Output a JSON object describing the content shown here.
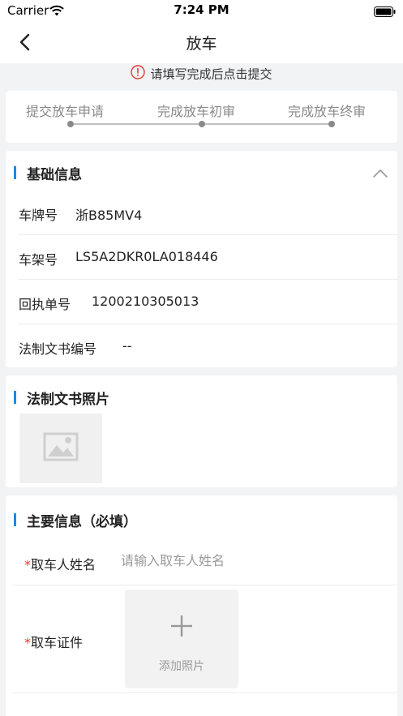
{
  "status_bar": {
    "carrier": "Carrier",
    "time": "7:24 PM"
  },
  "nav": {
    "title": "放车"
  },
  "notice": {
    "text": "请填写完成后点击提交"
  },
  "steps": [
    {
      "label": "提交放车申请"
    },
    {
      "label": "完成放车初审"
    },
    {
      "label": "完成放车终审"
    }
  ],
  "basic_info": {
    "title": "基础信息",
    "rows": [
      {
        "label": "车牌号",
        "value": "浙B85MV4"
      },
      {
        "label": "车架号",
        "value": "LS5A2DKR0LA018446"
      },
      {
        "label": "回执单号",
        "value": "1200210305013"
      },
      {
        "label": "法制文书编号",
        "value": "--"
      }
    ]
  },
  "doc_photo": {
    "title": "法制文书照片"
  },
  "main_info": {
    "title": "主要信息（必填）",
    "pickup_name": {
      "required_mark": "*",
      "label": "取车人姓名",
      "placeholder": "请输入取车人姓名",
      "value": ""
    },
    "pickup_id": {
      "required_mark": "*",
      "label": "取车证件",
      "upload_label": "添加照片"
    }
  },
  "icons": [
    "wifi-icon",
    "battery-icon",
    "back-arrow-icon",
    "info-icon",
    "chevron-up-icon",
    "image-placeholder-icon",
    "plus-icon"
  ],
  "colors": {
    "accent": "#1e88e5",
    "required": "#e53935",
    "step_text": "#8a8a8a",
    "notice_icon": "#e53935"
  }
}
